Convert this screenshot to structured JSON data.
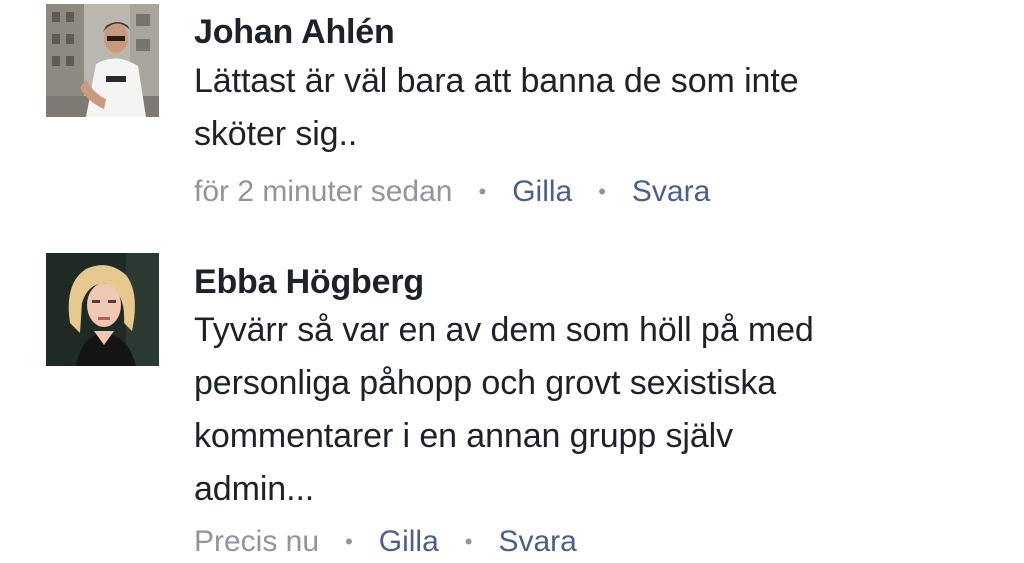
{
  "comments": [
    {
      "author": "Johan Ahlén",
      "lines": [
        "Lättast är väl bara att banna de som inte",
        "sköter sig.."
      ],
      "time": "för 2 minuter sedan",
      "like_label": "Gilla",
      "reply_label": "Svara",
      "separator": "•"
    },
    {
      "author": "Ebba Högberg",
      "lines": [
        "Tyvärr så var en av dem som höll på med",
        "personliga påhopp och grovt sexistiska",
        "kommentarer i en annan grupp själv",
        "admin..."
      ],
      "time": "Precis nu",
      "like_label": "Gilla",
      "reply_label": "Svara",
      "separator": "•"
    }
  ],
  "colors": {
    "author_text": "#1d2129",
    "meta_time": "#90949c",
    "action_link": "#4b5f8b"
  }
}
